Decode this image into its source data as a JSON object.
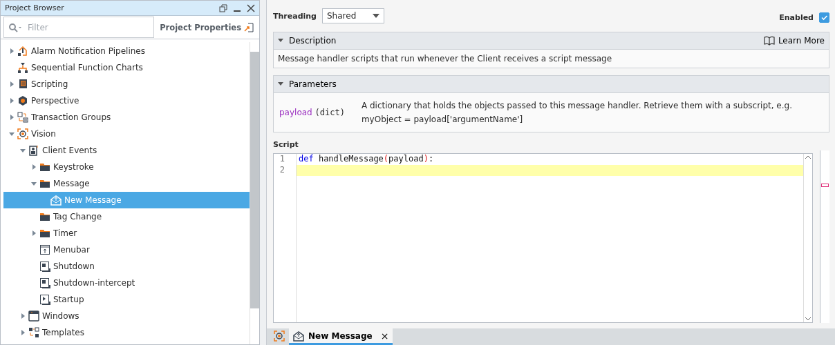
{
  "project_browser": {
    "title": "Project Browser",
    "filter": {
      "placeholder": "Filter"
    },
    "project_properties": "Project Properties",
    "tree": [
      {
        "label": "Alarm Notification Pipelines",
        "kind": "pipeline",
        "expanded": false,
        "selected": false
      },
      {
        "label": "Sequential Function Charts",
        "kind": "chart",
        "selected": false
      },
      {
        "label": "Scripting",
        "kind": "script",
        "expanded": false,
        "selected": false
      },
      {
        "label": "Perspective",
        "kind": "perspective",
        "expanded": false,
        "selected": false
      },
      {
        "label": "Transaction Groups",
        "kind": "transaction",
        "expanded": false,
        "selected": false
      },
      {
        "label": "Vision",
        "kind": "vision",
        "expanded": true,
        "selected": false,
        "children": [
          {
            "label": "Client Events",
            "kind": "client",
            "expanded": true,
            "selected": false,
            "children": [
              {
                "label": "Keystroke",
                "kind": "folder",
                "expanded": false,
                "selected": false
              },
              {
                "label": "Message",
                "kind": "folder",
                "expanded": true,
                "selected": false,
                "children": [
                  {
                    "label": "New Message",
                    "kind": "message",
                    "selected": true
                  }
                ]
              },
              {
                "label": "Tag Change",
                "kind": "folder",
                "selected": false
              },
              {
                "label": "Timer",
                "kind": "folder",
                "expanded": false,
                "selected": false
              },
              {
                "label": "Menubar",
                "kind": "menubar",
                "selected": false
              },
              {
                "label": "Shutdown",
                "kind": "shutdown",
                "selected": false
              },
              {
                "label": "Shutdown-intercept",
                "kind": "shutdown",
                "selected": false
              },
              {
                "label": "Startup",
                "kind": "startup",
                "selected": false
              }
            ]
          },
          {
            "label": "Windows",
            "kind": "windows",
            "expanded": false,
            "selected": false
          },
          {
            "label": "Templates",
            "kind": "templates",
            "expanded": false,
            "selected": false
          }
        ]
      }
    ]
  },
  "editor": {
    "threading": {
      "label": "Threading",
      "value": "Shared"
    },
    "enabled": {
      "label": "Enabled",
      "checked": true
    },
    "description": {
      "title": "Description",
      "expanded": true,
      "learn_more": "Learn More",
      "text": "Message handler scripts that run whenever the Client receives a script message"
    },
    "parameters": {
      "title": "Parameters",
      "expanded": true,
      "items": [
        {
          "name": "payload",
          "type": "(dict)",
          "text": "A dictionary that holds the objects passed to this message handler. Retrieve them with a subscript, e.g. myObject = payload['argumentName']"
        }
      ]
    },
    "script": {
      "label": "Script",
      "lines": [
        {
          "number": "1",
          "current": false,
          "tokens": [
            {
              "kind": "keyword",
              "text": "def"
            },
            {
              "kind": "plain",
              "text": " handleMessage"
            },
            {
              "kind": "paren",
              "text": "("
            },
            {
              "kind": "plain",
              "text": "payload"
            },
            {
              "kind": "paren",
              "text": ")"
            },
            {
              "kind": "plain",
              "text": ":"
            }
          ]
        },
        {
          "number": "2",
          "current": true
        }
      ]
    }
  },
  "tabs": [
    {
      "kind": "icon",
      "selected": false
    },
    {
      "kind": "text",
      "label": "New Message",
      "close": "×",
      "selected": true
    }
  ]
}
